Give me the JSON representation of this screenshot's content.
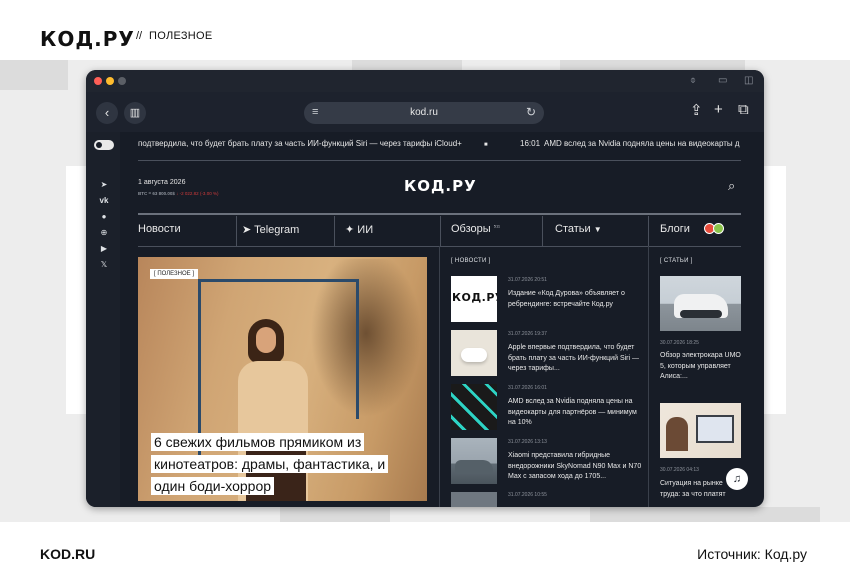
{
  "page": {
    "brand": "КОД.РУ",
    "separator": "//",
    "section": "ПОЛЕЗНОЕ",
    "footer_left": "KOD.RU",
    "footer_right": "Источник: Код.ру"
  },
  "browser": {
    "url": "kod.ru",
    "traffic_lights": [
      "#ff5f57",
      "#febc2e",
      "#5b5f66"
    ]
  },
  "site": {
    "ticker_1": "подтвердила, что будет брать плату за часть ИИ-функций Siri — через тарифы iCloud+",
    "ticker_2_time": "16:01",
    "ticker_2_text": "AMD вслед за Nvidia подняла цены на видеокарты д",
    "date": "1 августа 2026",
    "rates_prefix": "BTC = 63 800.00$",
    "rates_change": "↓ -2 022.82 (-3.00 %)",
    "logo": "КОД.РУ",
    "nav": {
      "news": "Новости",
      "telegram": "Telegram",
      "ai": "ИИ",
      "reviews": "Обзоры",
      "reviews_count": "511",
      "articles": "Статьи",
      "blogs": "Блоги"
    },
    "hero": {
      "badge": "[ ПОЛЕЗНОЕ ]",
      "title": "6 свежих фильмов прямиком из кинотеатров: драмы, фантастика, и один боди-хоррор"
    },
    "news_label": "[ НОВОСТИ ]",
    "news": [
      {
        "time": "31.07.2026 20:51",
        "text": "Издание «Код Дурова» объявляет о ребрендинге: встречайте Код.ру",
        "thumb_text": "КОД.РУ"
      },
      {
        "time": "31.07.2026 19:37",
        "text": "Apple впервые подтвердила, что будет брать плату за часть ИИ-функций Siri — через тарифы..."
      },
      {
        "time": "31.07.2026 16:01",
        "text": "AMD вслед за Nvidia подняла цены на видеокарты для партнёров — минимум на 10%"
      },
      {
        "time": "31.07.2026 13:13",
        "text": "Xiaomi представила гибридные внедорожники SkyNomad N90 Max и N70 Max с запасом хода до 1705..."
      },
      {
        "time": "31.07.2026 10:55",
        "text": ""
      }
    ],
    "articles_label": "[ СТАТЬИ ]",
    "articles": [
      {
        "date": "30.07.2026 18:25",
        "text": "Обзор электрокара UMO 5, которым управляет Алиса:..."
      },
      {
        "date": "30.07.2026 04:13",
        "text": "Ситуация на рынке труда: за что платят"
      }
    ]
  }
}
